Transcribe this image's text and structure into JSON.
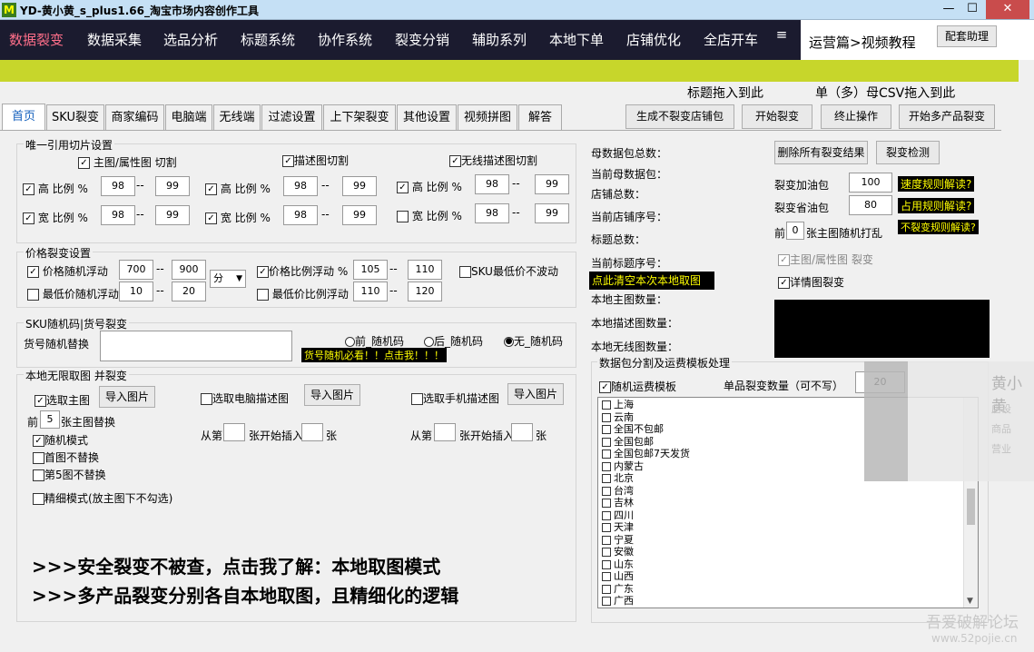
{
  "window": {
    "title": "YD-黄小黄_s_plus1.66_淘宝市场内容创作工具",
    "logo": "M",
    "min": "—",
    "restore": "☐",
    "close": "✕"
  },
  "menu": {
    "items": [
      "数据裂变",
      "数据采集",
      "选品分析",
      "标题系统",
      "协作系统",
      "裂变分销",
      "辅助系列",
      "本地下单",
      "店铺优化",
      "全店开车"
    ],
    "more": "≡",
    "course": "运营篇>视频教程",
    "helper": "配套助理"
  },
  "drops": {
    "title": "标题拖入到此",
    "csv": "单（多）母CSV拖入到此"
  },
  "tabs": [
    "首页",
    "SKU裂变",
    "商家编码",
    "电脑端",
    "无线端",
    "过滤设置",
    "上下架裂变",
    "其他设置",
    "视频拼图",
    "解答"
  ],
  "actions": [
    "生成不裂变店铺包",
    "开始裂变",
    "终止操作",
    "开始多产品裂变"
  ],
  "slice": {
    "title": "唯一引用切片设置",
    "main": "主图/属性图 切割",
    "desc": "描述图切割",
    "wireless": "无线描述图切割",
    "high": "高 比例 %",
    "wide": "宽 比例 %",
    "dash": "--",
    "g1": {
      "h1": "98",
      "h2": "99",
      "w1": "98",
      "w2": "99"
    },
    "g2": {
      "h1": "98",
      "h2": "99",
      "w1": "98",
      "w2": "99"
    },
    "g3": {
      "h1": "98",
      "h2": "99",
      "w1": "98",
      "w2": "99"
    }
  },
  "price": {
    "title": "价格裂变设置",
    "random": "价格随机浮动",
    "r1": "700",
    "r2": "900",
    "unit": "分",
    "ratio": "价格比例浮动 %",
    "p1": "105",
    "p2": "110",
    "sku_low": "SKU最低价不波动",
    "low_random": "最低价随机浮动",
    "l1": "10",
    "l2": "20",
    "low_ratio": "最低价比例浮动",
    "q1": "110",
    "q2": "120"
  },
  "sku": {
    "title": "SKU随机码|货号裂变",
    "replace": "货号随机替换",
    "before": "前_随机码",
    "after": "后_随机码",
    "none": "无_随机码",
    "must": "货号随机必看！！点击我！！！"
  },
  "local": {
    "title": "本地无限取图  并裂变",
    "pick_main": "选取主图",
    "import": "导入图片",
    "pick_pc": "选取电脑描述图",
    "pick_mobile": "选取手机描述图",
    "front": "前",
    "front_val": "5",
    "front_suffix": "张主图替换",
    "from": "从第",
    "insert": "张开始插入",
    "zhang": "张",
    "random_mode": "随机模式",
    "first_no": "首图不替换",
    "fifth_no": "第5图不替换",
    "fine": "精细模式(放主图下不勾选)"
  },
  "promo": {
    "line1": ">>>安全裂变不被查，点击我了解：本地取图模式",
    "line2": ">>>多产品裂变分别各自本地取图，且精细化的逻辑"
  },
  "stats": [
    "母数据包总数：",
    "当前母数据包：",
    "店铺总数：",
    "当前店铺序号：",
    "标题总数：",
    "当前标题序号："
  ],
  "clear": "点此清空本次本地取图",
  "local_stats": [
    "本地主图数量：",
    "本地描述图数量：",
    "本地无线图数量："
  ],
  "right": {
    "del": "删除所有裂变结果",
    "check": "裂变检测",
    "oil_add": "裂变加油包",
    "oil_add_val": "100",
    "oil_save": "裂变省油包",
    "oil_save_val": "80",
    "speed": "速度规则解读?",
    "usage": "占用规则解读?",
    "nosplit": "不裂变规则解读?",
    "front": "前",
    "front_val": "0",
    "front_suffix": "张主图随机打乱",
    "main_split": "主图/属性图 裂变",
    "detail_split": "详情图裂变"
  },
  "freight": {
    "title": "数据包分割及运费模板处理",
    "random_tpl": "随机运费模板",
    "count_label": "单品裂变数量（可不写）",
    "count": "20",
    "provinces": [
      "上海",
      "云南",
      "全国不包邮",
      "全国包邮",
      "全国包邮7天发货",
      "内蒙古",
      "北京",
      "台湾",
      "吉林",
      "四川",
      "天津",
      "宁夏",
      "安徽",
      "山东",
      "山西",
      "广东",
      "广西"
    ]
  },
  "side": {
    "name": "黄小黄",
    "l1": "店设",
    "l2": "商品",
    "l3": "营业"
  },
  "watermark": {
    "l1": "吾爱破解论坛",
    "l2": "www.52pojie.cn"
  }
}
